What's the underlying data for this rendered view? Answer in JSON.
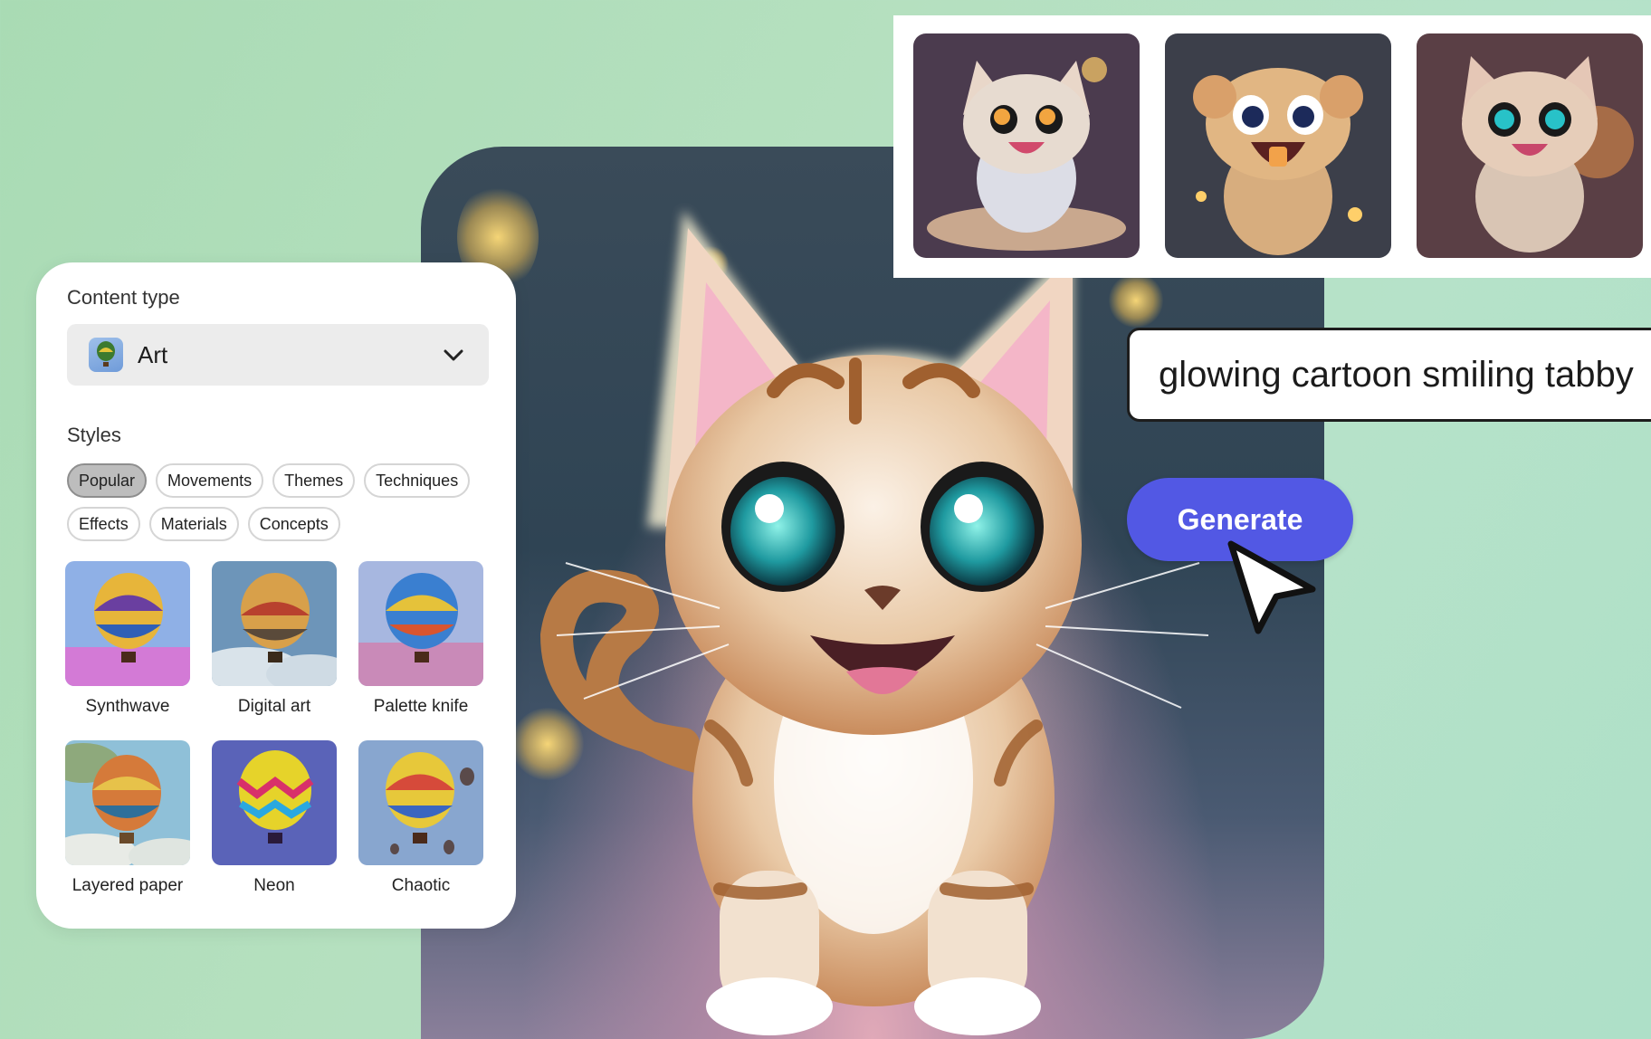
{
  "thumbnails": [
    {
      "icon": "cat-variation-1-image"
    },
    {
      "icon": "cat-variation-2-image"
    },
    {
      "icon": "cat-variation-3-image"
    }
  ],
  "prompt": {
    "text": "glowing cartoon smiling tabby"
  },
  "generate": {
    "label": "Generate"
  },
  "panel": {
    "content_type_label": "Content type",
    "content_type_value": "Art",
    "styles_label": "Styles",
    "chips": [
      {
        "label": "Popular",
        "selected": true
      },
      {
        "label": "Movements",
        "selected": false
      },
      {
        "label": "Themes",
        "selected": false
      },
      {
        "label": "Techniques",
        "selected": false
      },
      {
        "label": "Effects",
        "selected": false
      },
      {
        "label": "Materials",
        "selected": false
      },
      {
        "label": "Concepts",
        "selected": false
      }
    ],
    "styles": [
      {
        "label": "Synthwave"
      },
      {
        "label": "Digital art"
      },
      {
        "label": "Palette knife"
      },
      {
        "label": "Layered paper"
      },
      {
        "label": "Neon"
      },
      {
        "label": "Chaotic"
      }
    ]
  },
  "colors": {
    "accent": "#5258e4",
    "background": "#b3dfc0",
    "chip_selected": "#bdbdbd"
  }
}
